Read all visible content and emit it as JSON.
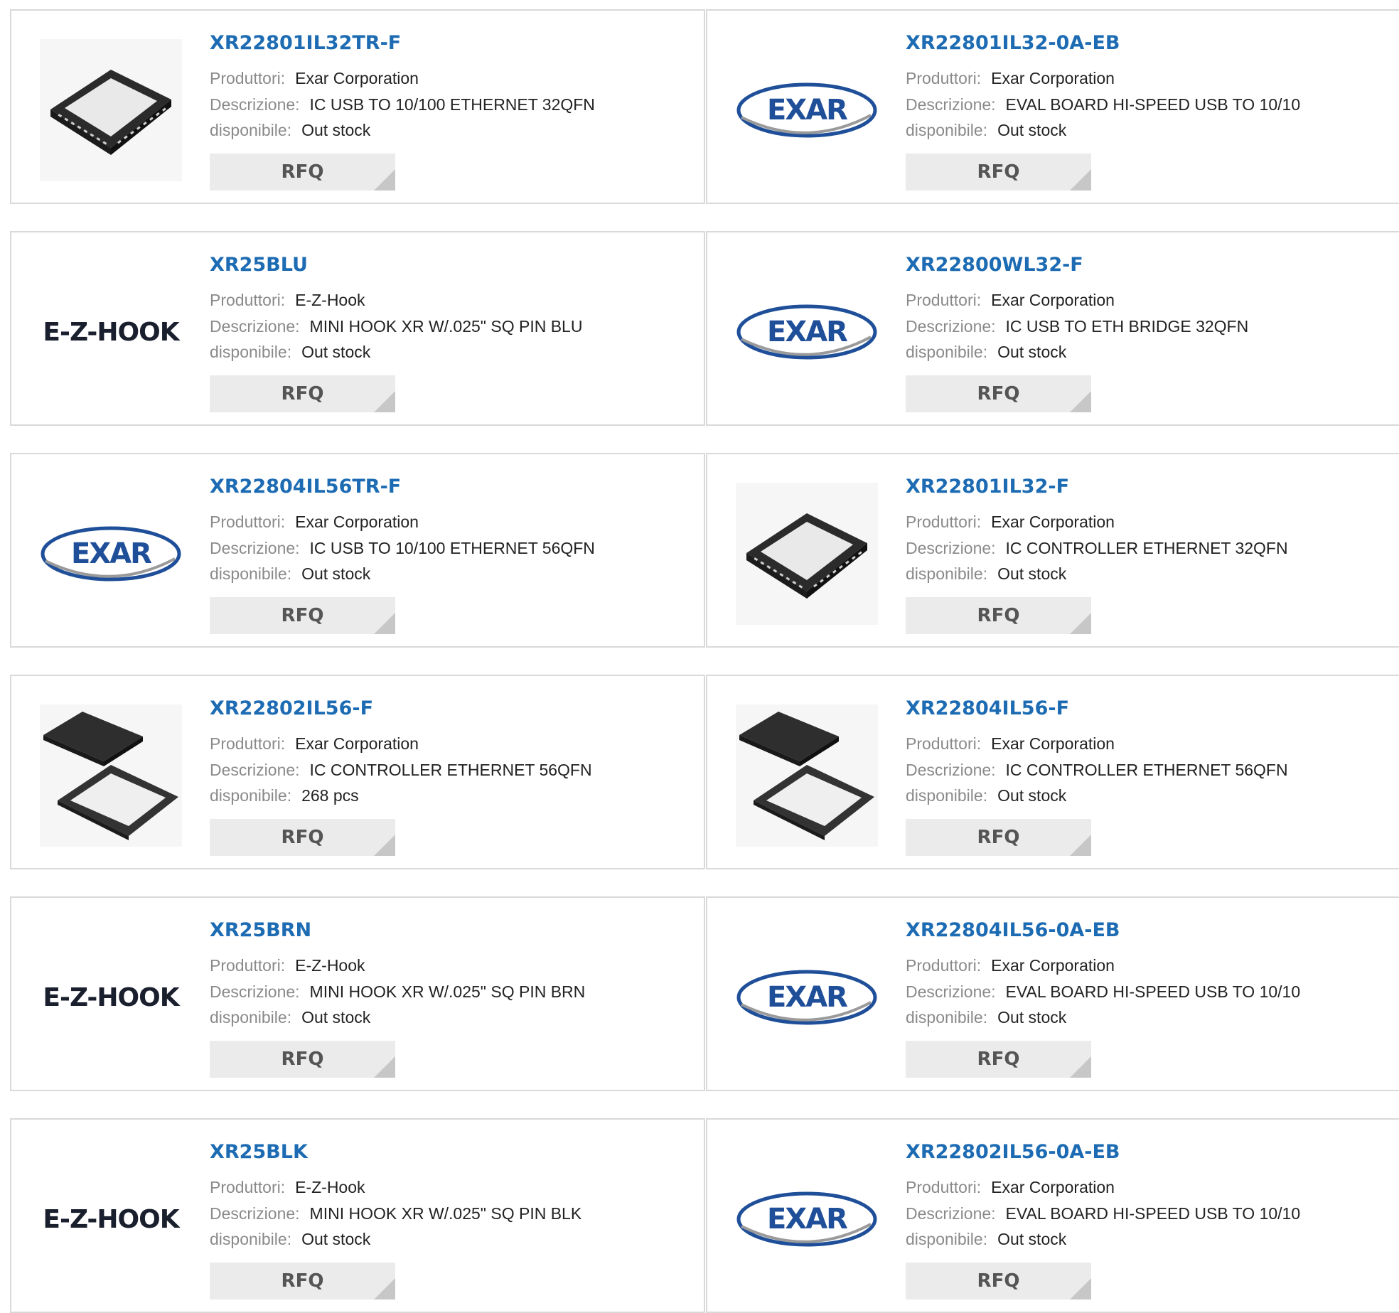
{
  "labels": {
    "produttori": "Produttori:",
    "descrizione": "Descrizione:",
    "disponibile": "disponibile:",
    "rfq": "RFQ"
  },
  "colors": {
    "title": "#1c6bb3",
    "label": "#8a8a8a",
    "value": "#222222",
    "border": "#d9d9d9",
    "button_bg": "#ebebeb",
    "exar_blue": "#1f4f99"
  },
  "products": [
    {
      "part": "XR22801IL32TR-F",
      "manufacturer": "Exar Corporation",
      "description": "IC USB TO 10/100 ETHERNET 32QFN",
      "availability": "Out stock",
      "image": "qfn-chip"
    },
    {
      "part": "XR22801IL32-0A-EB",
      "manufacturer": "Exar Corporation",
      "description": "EVAL BOARD HI-SPEED USB TO 10/10",
      "availability": "Out stock",
      "image": "exar-logo"
    },
    {
      "part": "XR25BLU",
      "manufacturer": "E-Z-Hook",
      "description": "MINI HOOK XR W/.025\" SQ PIN BLU",
      "availability": "Out stock",
      "image": "ezhook-logo"
    },
    {
      "part": "XR22800WL32-F",
      "manufacturer": "Exar Corporation",
      "description": "IC USB TO ETH BRIDGE 32QFN",
      "availability": "Out stock",
      "image": "exar-logo"
    },
    {
      "part": "XR22804IL56TR-F",
      "manufacturer": "Exar Corporation",
      "description": "IC USB TO 10/100 ETHERNET 56QFN",
      "availability": "Out stock",
      "image": "exar-logo"
    },
    {
      "part": "XR22801IL32-F",
      "manufacturer": "Exar Corporation",
      "description": "IC CONTROLLER ETHERNET 32QFN",
      "availability": "Out stock",
      "image": "qfn-chip"
    },
    {
      "part": "XR22802IL56-F",
      "manufacturer": "Exar Corporation",
      "description": "IC CONTROLLER ETHERNET 56QFN",
      "availability": "268 pcs",
      "image": "qfn-chip-pair"
    },
    {
      "part": "XR22804IL56-F",
      "manufacturer": "Exar Corporation",
      "description": "IC CONTROLLER ETHERNET 56QFN",
      "availability": "Out stock",
      "image": "qfn-chip-pair"
    },
    {
      "part": "XR25BRN",
      "manufacturer": "E-Z-Hook",
      "description": "MINI HOOK XR W/.025\" SQ PIN BRN",
      "availability": "Out stock",
      "image": "ezhook-logo"
    },
    {
      "part": "XR22804IL56-0A-EB",
      "manufacturer": "Exar Corporation",
      "description": "EVAL BOARD HI-SPEED USB TO 10/10",
      "availability": "Out stock",
      "image": "exar-logo"
    },
    {
      "part": "XR25BLK",
      "manufacturer": "E-Z-Hook",
      "description": "MINI HOOK XR W/.025\" SQ PIN BLK",
      "availability": "Out stock",
      "image": "ezhook-logo"
    },
    {
      "part": "XR22802IL56-0A-EB",
      "manufacturer": "Exar Corporation",
      "description": "EVAL BOARD HI-SPEED USB TO 10/10",
      "availability": "Out stock",
      "image": "exar-logo"
    }
  ],
  "logos": {
    "exar": "EXAR",
    "ezhook": "E-Z-HOOK"
  }
}
